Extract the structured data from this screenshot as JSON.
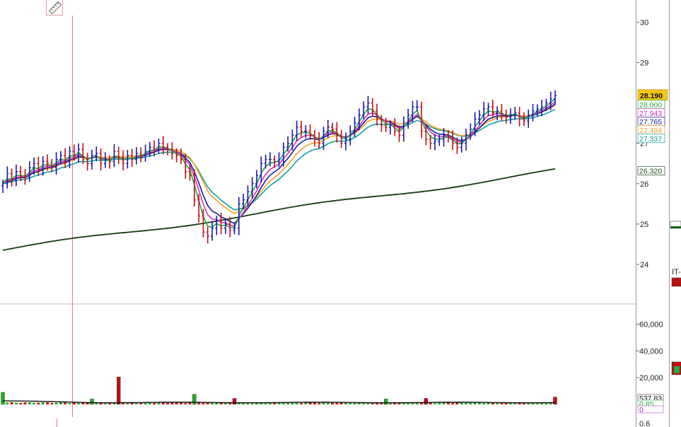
{
  "chart_data": {
    "type": "candlestick",
    "price_axis": {
      "ylim": [
        23.02,
        30.55
      ],
      "ticks": [
        24,
        25,
        26,
        27,
        29,
        30
      ]
    },
    "volume_axis": {
      "ylim": [
        0,
        75000
      ],
      "ticks": [
        "20,000",
        "40,000",
        "60,000"
      ],
      "bottom_tick": "0.6"
    },
    "last_price": "28.190",
    "value_tags": [
      {
        "text": "28.000",
        "value": 28.0,
        "color": "#22aa44"
      },
      {
        "text": "27.943",
        "value": 27.943,
        "color": "#cc33aa"
      },
      {
        "text": "27.765",
        "value": 27.765,
        "color": "#1a1a9a"
      },
      {
        "text": "27.484",
        "value": 27.484,
        "color": "#f0a020"
      },
      {
        "text": "27.337",
        "value": 27.337,
        "color": "#13a0a0"
      },
      {
        "text": "26.320",
        "value": 26.32,
        "color": "#1a4a1a"
      }
    ],
    "volume_tags": [
      "537.83",
      "0.85",
      "0"
    ],
    "right_panel_text": "IT-",
    "colors": {
      "up": "#1a1aaa",
      "down": "#bb1111",
      "ma_green": "#22aa44",
      "ma_magenta": "#dd33bb",
      "ma_navy": "#1a1a9a",
      "ma_orange": "#f5a020",
      "ma_teal": "#13a0a0",
      "ma_darkgreen": "#103a10",
      "last_price_bg": "#f5c518",
      "grid": "#bbbbbb",
      "cursor": "#e07070"
    },
    "closes": [
      26.0,
      26.25,
      26.1,
      26.3,
      26.2,
      26.15,
      26.4,
      26.5,
      26.35,
      26.55,
      26.5,
      26.4,
      26.6,
      26.7,
      26.55,
      26.8,
      26.7,
      26.85,
      26.6,
      26.5,
      26.7,
      26.75,
      26.5,
      26.6,
      26.55,
      26.8,
      26.65,
      26.5,
      26.7,
      26.6,
      26.75,
      26.7,
      26.8,
      26.9,
      26.85,
      27.0,
      26.9,
      26.85,
      26.75,
      26.7,
      26.6,
      26.3,
      26.2,
      25.6,
      25.2,
      24.8,
      24.7,
      24.9,
      25.1,
      24.9,
      25.0,
      24.85,
      24.9,
      25.5,
      25.6,
      25.8,
      26.0,
      26.2,
      26.5,
      26.6,
      26.6,
      26.55,
      26.6,
      26.9,
      27.0,
      27.2,
      27.4,
      27.3,
      27.3,
      27.2,
      27.1,
      27.0,
      27.3,
      27.4,
      27.35,
      27.2,
      27.0,
      27.1,
      27.3,
      27.5,
      27.7,
      27.9,
      28.0,
      27.8,
      27.6,
      27.45,
      27.4,
      27.45,
      27.3,
      27.2,
      27.5,
      27.7,
      27.9,
      27.9,
      27.3,
      27.1,
      27.0,
      27.05,
      27.1,
      27.2,
      27.15,
      27.0,
      26.9,
      27.0,
      27.2,
      27.35,
      27.6,
      27.7,
      27.85,
      27.9,
      27.75,
      27.8,
      27.7,
      27.65,
      27.7,
      27.75,
      27.6,
      27.55,
      27.7,
      27.8,
      27.85,
      27.9,
      28.0,
      28.1,
      28.19
    ],
    "volume_spikes": [
      {
        "bar": 0,
        "value": 9000,
        "color": "#22aa22"
      },
      {
        "bar": 20,
        "value": 4000,
        "color": "#22aa22"
      },
      {
        "bar": 26,
        "value": 20500,
        "color": "#bb1111"
      },
      {
        "bar": 43,
        "value": 7500,
        "color": "#22aa22"
      },
      {
        "bar": 52,
        "value": 4500,
        "color": "#bb1111"
      },
      {
        "bar": 86,
        "value": 4000,
        "color": "#22aa22"
      },
      {
        "bar": 95,
        "value": 4500,
        "color": "#bb1111"
      },
      {
        "bar": 124,
        "value": 5500,
        "color": "#bb1111"
      }
    ]
  }
}
